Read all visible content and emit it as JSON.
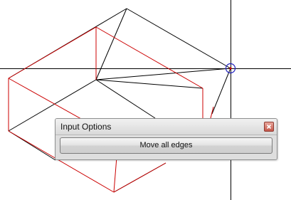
{
  "panel": {
    "title": "Input Options",
    "close_icon": "close-icon",
    "button_label": "Move all edges"
  },
  "viewport": {
    "edge_colors": {
      "selected": "#cc0000",
      "default": "#000000",
      "snap_marker": "#2020c0"
    },
    "icons": [
      "crosshair-icon",
      "snap-point-icon"
    ]
  }
}
